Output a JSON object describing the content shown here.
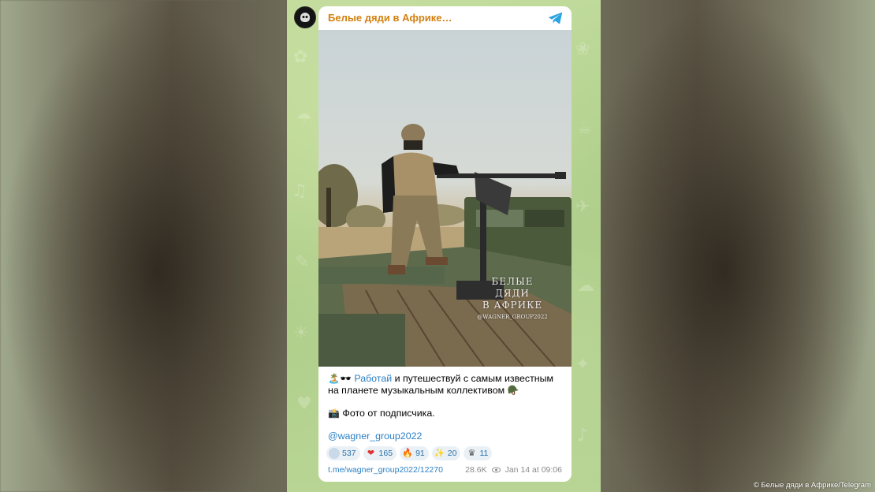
{
  "channel": {
    "title": "Белые дяди в Африке…"
  },
  "post": {
    "line1_prefix_emoji": "🏝️🕶️",
    "line1_link": "Работай",
    "line1_rest": " и путешествуй с самым известным на планете музыкальным коллективом",
    "line1_suffix_emoji": "🪖",
    "photo_emoji": "📸",
    "photo_caption": "Фото от подписчика.",
    "handle": "@wagner_group2022",
    "watermark_line1": "БЕЛЫЕ ДЯДИ",
    "watermark_line2": "В АФРИКЕ",
    "watermark_line3": "@WAGNER_GROUP2022"
  },
  "reactions": [
    {
      "icon": "dots-reaction-icon",
      "glyph": "",
      "count": "537",
      "color": "#c9d9e8"
    },
    {
      "icon": "heart-fire-icon",
      "glyph": "❤",
      "count": "165",
      "color": "#e03030"
    },
    {
      "icon": "fire-icon",
      "glyph": "🔥",
      "count": "91",
      "color": "#f07a18"
    },
    {
      "icon": "party-popper-icon",
      "glyph": "✨",
      "count": "20",
      "color": "#f2b21c"
    },
    {
      "icon": "crown-icon",
      "glyph": "♛",
      "count": "11",
      "color": "#555555"
    }
  ],
  "footer": {
    "link": "t.me/wagner_group2022/12270",
    "views": "28.6K",
    "date": "Jan 14 at 09:06"
  },
  "credit": "© Белые дяди в Африке/Telegram",
  "colors": {
    "channel_title": "#d3800f",
    "link": "#2a7fc4",
    "telegram": "#2aa3e0"
  }
}
